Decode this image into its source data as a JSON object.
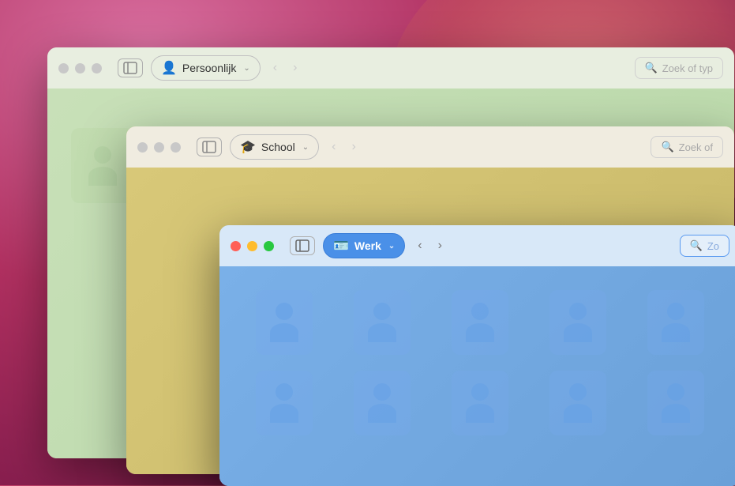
{
  "background": {
    "color": "#b03060"
  },
  "windows": {
    "persoonlijk": {
      "title": "Persoonlijk",
      "icon": "person-icon",
      "search_placeholder": "Zoek of typ",
      "nav_back_label": "‹",
      "nav_forward_label": "›",
      "profile_label": "Persoonlijk",
      "chevron": "∨"
    },
    "school": {
      "title": "School",
      "icon": "graduation-cap-icon",
      "search_placeholder": "Zoek of",
      "nav_back_label": "‹",
      "nav_forward_label": "›",
      "profile_label": "School",
      "chevron": "∨"
    },
    "werk": {
      "title": "Werk",
      "icon": "person-badge-icon",
      "search_placeholder": "Zo",
      "nav_back_label": "‹",
      "nav_forward_label": "›",
      "profile_label": "Werk",
      "chevron": "∨"
    }
  },
  "labels": {
    "search_icon": "🔍",
    "sidebar_toggle": "sidebar",
    "back": "<",
    "forward": ">"
  }
}
